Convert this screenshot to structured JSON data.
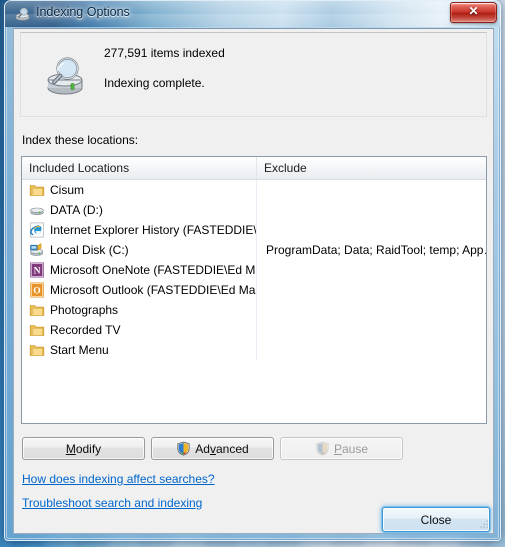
{
  "window": {
    "title": "Indexing Options",
    "title_icon": "indexing-options-icon",
    "close_x_label": "✕"
  },
  "status": {
    "icon": "drive-magnifier-icon",
    "items_indexed": "277,591 items indexed",
    "state": "Indexing complete."
  },
  "section": {
    "label": "Index these locations:"
  },
  "list": {
    "columns": [
      {
        "key": "included",
        "label": "Included Locations"
      },
      {
        "key": "exclude",
        "label": "Exclude"
      }
    ],
    "rows": [
      {
        "icon": "folder-icon",
        "label": "Cisum",
        "exclude": ""
      },
      {
        "icon": "drive-icon",
        "label": "DATA (D:)",
        "exclude": ""
      },
      {
        "icon": "internet-explorer-icon",
        "label": "Internet Explorer History (FASTEDDIE\\E…",
        "exclude": ""
      },
      {
        "icon": "local-disk-icon",
        "label": "Local Disk (C:)",
        "exclude": "ProgramData; Data; RaidTool; temp; App…"
      },
      {
        "icon": "onenote-icon",
        "label": "Microsoft OneNote (FASTEDDIE\\Ed Marr…",
        "exclude": ""
      },
      {
        "icon": "outlook-icon",
        "label": "Microsoft Outlook (FASTEDDIE\\Ed Marro…",
        "exclude": ""
      },
      {
        "icon": "folder-icon",
        "label": "Photographs",
        "exclude": ""
      },
      {
        "icon": "folder-icon",
        "label": "Recorded TV",
        "exclude": ""
      },
      {
        "icon": "folder-icon",
        "label": "Start Menu",
        "exclude": ""
      }
    ]
  },
  "buttons": {
    "modify": {
      "label": "Modify",
      "accel": "M",
      "enabled": true,
      "shield": false
    },
    "advanced": {
      "label": "Advanced",
      "accel": "v",
      "enabled": true,
      "shield": true
    },
    "pause": {
      "label": "Pause",
      "accel": "P",
      "enabled": false,
      "shield": true
    },
    "close": {
      "label": "Close"
    }
  },
  "links": {
    "how": "How does indexing affect searches?",
    "troubleshoot": "Troubleshoot search and indexing"
  },
  "colors": {
    "link": "#0066CC",
    "close_button_border": "#3C97D4",
    "titlebar_close_red": "#C73226",
    "folder_yellow": "#F2C14B",
    "onenote_purple": "#80397B",
    "outlook_orange": "#E8A33D"
  }
}
